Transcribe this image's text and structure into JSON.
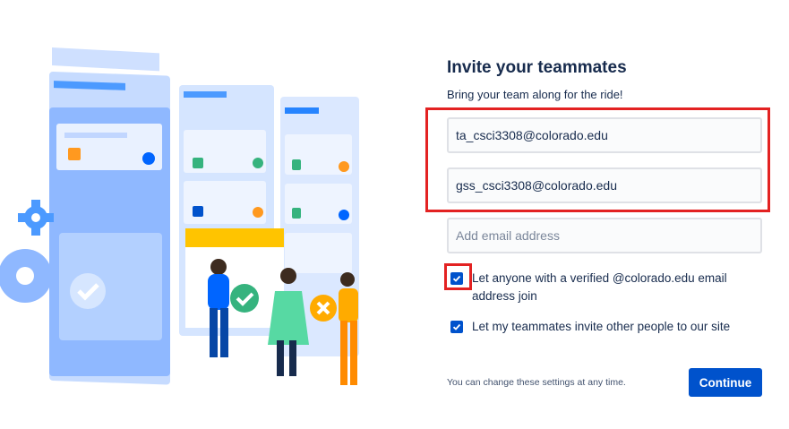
{
  "header": {
    "title": "Invite your teammates",
    "subtitle": "Bring your team along for the ride!"
  },
  "inputs": [
    {
      "value": "ta_csci3308@colorado.edu",
      "placeholder": ""
    },
    {
      "value": "gss_csci3308@colorado.edu",
      "placeholder": ""
    },
    {
      "value": "",
      "placeholder": "Add email address"
    }
  ],
  "options": [
    {
      "label": "Let anyone with a verified @colorado.edu email address join",
      "checked": true
    },
    {
      "label": "Let my teammates invite other people to our site",
      "checked": true
    }
  ],
  "footer": {
    "note": "You can change these settings at any time.",
    "continue_label": "Continue"
  },
  "colors": {
    "primary": "#0052cc",
    "highlight": "#e32222",
    "text": "#172b4d"
  },
  "icons": [
    "checkmark-icon",
    "gear-icon",
    "board-illustration"
  ]
}
